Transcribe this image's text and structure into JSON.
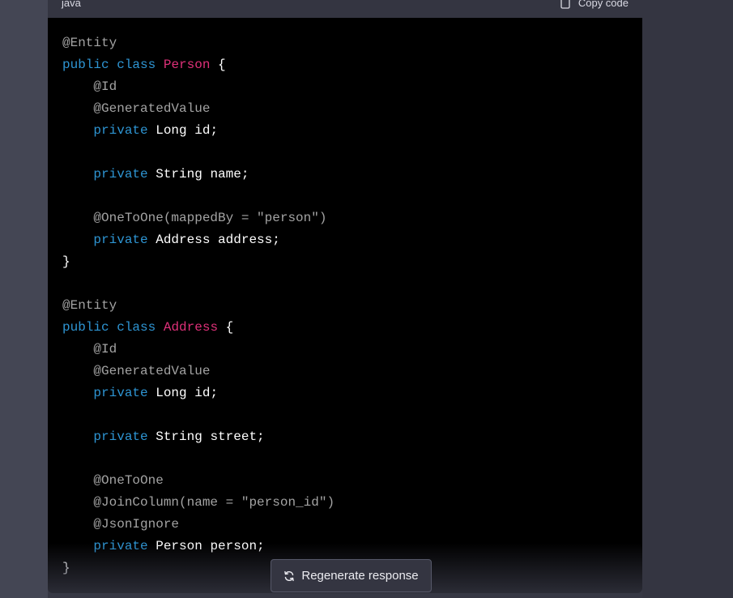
{
  "code_block": {
    "language": "java",
    "copy_label": "Copy code",
    "lines": [
      [
        {
          "t": "@Entity",
          "c": "ann"
        }
      ],
      [
        {
          "t": "public",
          "c": "kw"
        },
        {
          "t": " ",
          "c": "plain"
        },
        {
          "t": "class",
          "c": "kw"
        },
        {
          "t": " ",
          "c": "plain"
        },
        {
          "t": "Person",
          "c": "cls"
        },
        {
          "t": " {",
          "c": "plain"
        }
      ],
      [
        {
          "t": "    ",
          "c": "plain"
        },
        {
          "t": "@Id",
          "c": "ann"
        }
      ],
      [
        {
          "t": "    ",
          "c": "plain"
        },
        {
          "t": "@GeneratedValue",
          "c": "ann"
        }
      ],
      [
        {
          "t": "    ",
          "c": "plain"
        },
        {
          "t": "private",
          "c": "kw"
        },
        {
          "t": " Long id;",
          "c": "plain"
        }
      ],
      [],
      [
        {
          "t": "    ",
          "c": "plain"
        },
        {
          "t": "private",
          "c": "kw"
        },
        {
          "t": " String name;",
          "c": "plain"
        }
      ],
      [],
      [
        {
          "t": "    ",
          "c": "plain"
        },
        {
          "t": "@OneToOne(mappedBy = \"person\")",
          "c": "ann"
        }
      ],
      [
        {
          "t": "    ",
          "c": "plain"
        },
        {
          "t": "private",
          "c": "kw"
        },
        {
          "t": " Address address;",
          "c": "plain"
        }
      ],
      [
        {
          "t": "}",
          "c": "plain"
        }
      ],
      [],
      [
        {
          "t": "@Entity",
          "c": "ann"
        }
      ],
      [
        {
          "t": "public",
          "c": "kw"
        },
        {
          "t": " ",
          "c": "plain"
        },
        {
          "t": "class",
          "c": "kw"
        },
        {
          "t": " ",
          "c": "plain"
        },
        {
          "t": "Address",
          "c": "cls"
        },
        {
          "t": " {",
          "c": "plain"
        }
      ],
      [
        {
          "t": "    ",
          "c": "plain"
        },
        {
          "t": "@Id",
          "c": "ann"
        }
      ],
      [
        {
          "t": "    ",
          "c": "plain"
        },
        {
          "t": "@GeneratedValue",
          "c": "ann"
        }
      ],
      [
        {
          "t": "    ",
          "c": "plain"
        },
        {
          "t": "private",
          "c": "kw"
        },
        {
          "t": " Long id;",
          "c": "plain"
        }
      ],
      [],
      [
        {
          "t": "    ",
          "c": "plain"
        },
        {
          "t": "private",
          "c": "kw"
        },
        {
          "t": " String street;",
          "c": "plain"
        }
      ],
      [],
      [
        {
          "t": "    ",
          "c": "plain"
        },
        {
          "t": "@OneToOne",
          "c": "ann"
        }
      ],
      [
        {
          "t": "    ",
          "c": "plain"
        },
        {
          "t": "@JoinColumn(name = \"person_id\")",
          "c": "ann"
        }
      ],
      [
        {
          "t": "    ",
          "c": "plain"
        },
        {
          "t": "@JsonIgnore",
          "c": "ann"
        }
      ],
      [
        {
          "t": "    ",
          "c": "plain"
        },
        {
          "t": "private",
          "c": "kw"
        },
        {
          "t": " Person person;",
          "c": "plain"
        }
      ],
      [
        {
          "t": "}",
          "c": "plain"
        }
      ]
    ]
  },
  "regenerate_label": "Regenerate response",
  "icons": {
    "copy": "clipboard-icon",
    "regenerate": "refresh-icon"
  },
  "colors": {
    "keyword": "#2e95d3",
    "class_name": "#df3079",
    "annotation": "#a3a3a3",
    "code_background": "#000000",
    "header_background": "#343541"
  }
}
